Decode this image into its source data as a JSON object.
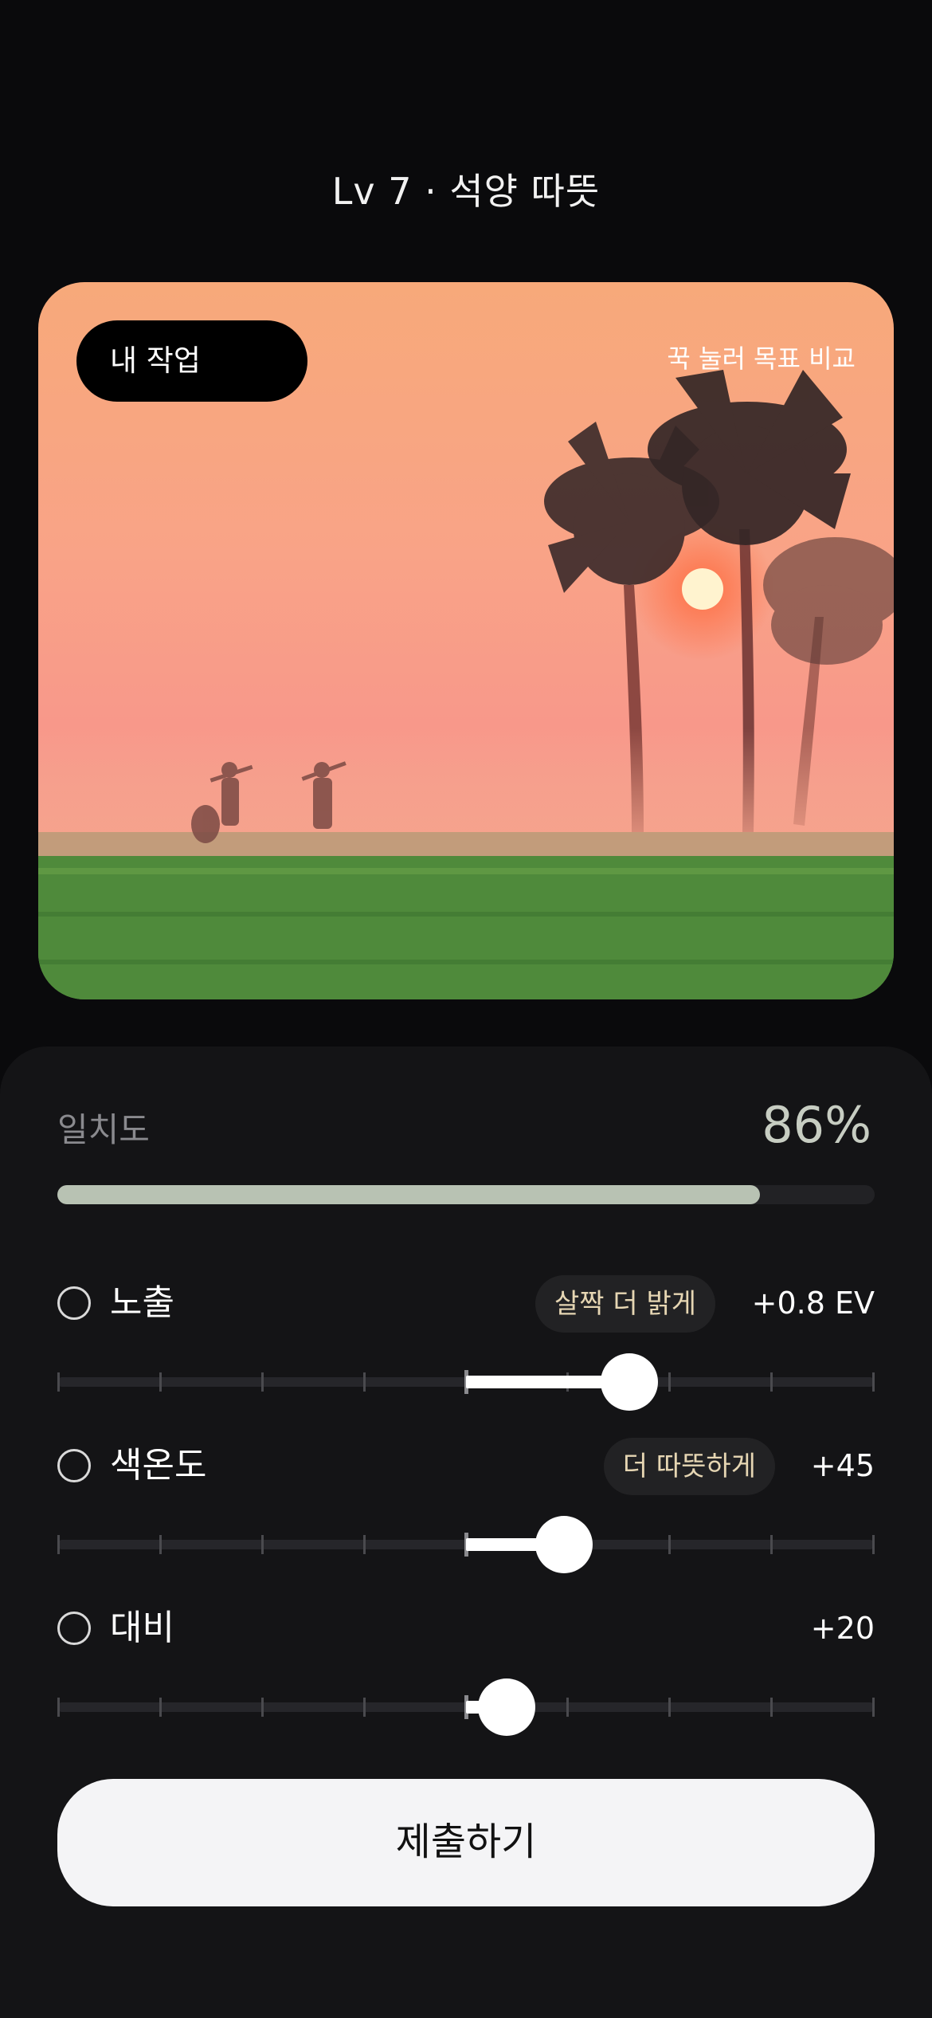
{
  "header": {
    "title": "Lv 7 · 석양 따뜻"
  },
  "photo": {
    "pill_label": "내 작업",
    "compare_hint": "꾹 눌러 목표 비교"
  },
  "match": {
    "label": "일치도",
    "value_text": "86%",
    "value": 0.86
  },
  "controls": [
    {
      "label": "노출",
      "chip": "살짝 더 밝게",
      "value_text": "+0.8 EV",
      "level": 0.2
    },
    {
      "label": "색온도",
      "chip": "더 따뜻하게",
      "value_text": "+45",
      "level": 0.12
    },
    {
      "label": "대비",
      "chip": "",
      "value_text": "+20",
      "level": 0.05
    }
  ],
  "submit": {
    "label": "제출하기"
  },
  "colors": {
    "accent": "#b8c2b3",
    "chip_text": "#e6d6b3",
    "background": "#0a0a0c",
    "panel": "#141416"
  }
}
